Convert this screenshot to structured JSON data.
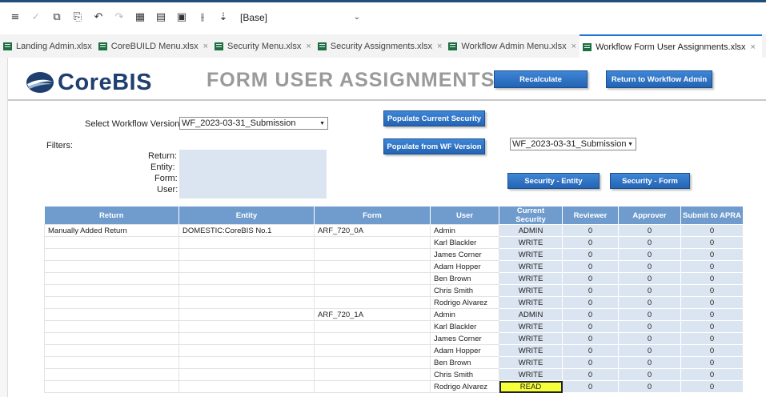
{
  "toolbar": {
    "icons": [
      "menu-icon",
      "check-icon",
      "copy-icon",
      "paste-icon",
      "undo-icon",
      "redo-icon",
      "format-icon",
      "table-icon",
      "grid-icon",
      "split-icon",
      "sort-icon"
    ],
    "base_select": "[Base]"
  },
  "tabs": [
    {
      "label": "Landing Admin.xlsx",
      "closable": false
    },
    {
      "label": "CoreBUILD Menu.xlsx",
      "closable": true
    },
    {
      "label": "Security Menu.xlsx",
      "closable": true
    },
    {
      "label": "Security Assignments.xlsx",
      "closable": true
    },
    {
      "label": "Workflow Admin Menu.xlsx",
      "closable": true
    },
    {
      "label": "Workflow Form User Assignments.xlsx",
      "closable": true,
      "active": true
    }
  ],
  "header": {
    "logo": "CoreBIS",
    "title": "FORM USER ASSIGNMENTS",
    "recalculate": "Recalculate",
    "return_admin": "Return to Workflow Admin"
  },
  "controls": {
    "select_version_label": "Select Workflow Version:",
    "select_version_value": "WF_2023-03-31_Submission",
    "populate_current": "Populate Current Security",
    "populate_wf": "Populate from WF Version",
    "wf_version_value": "WF_2023-03-31_Submission",
    "security_entity": "Security - Entity",
    "security_form": "Security - Form",
    "filters_label": "Filters:",
    "filter_return": "Return:",
    "filter_entity": "Entity:",
    "filter_form": "Form:",
    "filter_user": "User:"
  },
  "grid": {
    "columns": [
      "Return",
      "Entity",
      "Form",
      "User",
      "Current Security",
      "Reviewer",
      "Approver",
      "Submit to APRA"
    ],
    "rows": [
      [
        "Manually Added Return",
        "DOMESTIC:CoreBIS No.1",
        "ARF_720_0A",
        "Admin",
        "ADMIN",
        "0",
        "0",
        "0"
      ],
      [
        "",
        "",
        "",
        "Karl Blackler",
        "WRITE",
        "0",
        "0",
        "0"
      ],
      [
        "",
        "",
        "",
        "James Corner",
        "WRITE",
        "0",
        "0",
        "0"
      ],
      [
        "",
        "",
        "",
        "Adam Hopper",
        "WRITE",
        "0",
        "0",
        "0"
      ],
      [
        "",
        "",
        "",
        "Ben Brown",
        "WRITE",
        "0",
        "0",
        "0"
      ],
      [
        "",
        "",
        "",
        "Chris Smith",
        "WRITE",
        "0",
        "0",
        "0"
      ],
      [
        "",
        "",
        "",
        "Rodrigo Alvarez",
        "WRITE",
        "0",
        "0",
        "0"
      ],
      [
        "",
        "",
        "ARF_720_1A",
        "Admin",
        "ADMIN",
        "0",
        "0",
        "0"
      ],
      [
        "",
        "",
        "",
        "Karl Blackler",
        "WRITE",
        "0",
        "0",
        "0"
      ],
      [
        "",
        "",
        "",
        "James Corner",
        "WRITE",
        "0",
        "0",
        "0"
      ],
      [
        "",
        "",
        "",
        "Adam Hopper",
        "WRITE",
        "0",
        "0",
        "0"
      ],
      [
        "",
        "",
        "",
        "Ben Brown",
        "WRITE",
        "0",
        "0",
        "0"
      ],
      [
        "",
        "",
        "",
        "Chris Smith",
        "WRITE",
        "0",
        "0",
        "0"
      ],
      [
        "",
        "",
        "",
        "Rodrigo Alvarez",
        "READ",
        "0",
        "0",
        "0"
      ]
    ],
    "selected_row": 13
  },
  "colors": {
    "header_fill": "#6f9ccd",
    "filter_fill": "#dbe5f1",
    "button_fill": "#2e6fc0",
    "selected_cell": "#f5ff3a"
  }
}
